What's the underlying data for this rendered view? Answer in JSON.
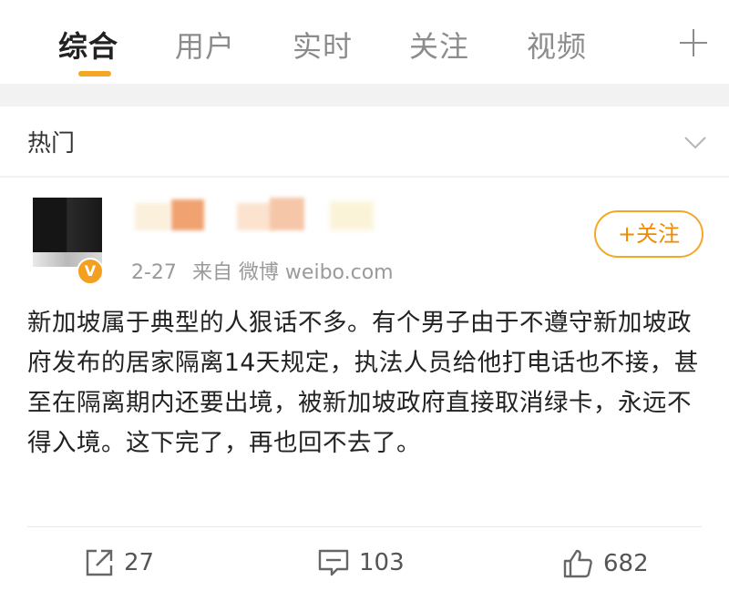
{
  "tabs": [
    {
      "label": "综合",
      "active": true
    },
    {
      "label": "用户",
      "active": false
    },
    {
      "label": "实时",
      "active": false
    },
    {
      "label": "关注",
      "active": false
    },
    {
      "label": "视频",
      "active": false
    }
  ],
  "hot_section": {
    "label": "热门"
  },
  "post": {
    "date": "2-27",
    "source": "来自 微博 weibo.com",
    "follow_label": "+关注",
    "badge": "V",
    "text": "新加坡属于典型的人狠话不多。有个男子由于不遵守新加坡政府发布的居家隔离14天规定，执法人员给他打电话也不接，甚至在隔离期内还要出境，被新加坡政府直接取消绿卡，永远不得入境。这下完了，再也回不去了。"
  },
  "actions": {
    "repost_count": "27",
    "comment_count": "103",
    "like_count": "682"
  },
  "colors": {
    "accent": "#f5a623",
    "follow_text": "#f08a00",
    "background": "#f2f2f2"
  },
  "icons": [
    "plus-icon",
    "chevron-down-icon",
    "verified-icon",
    "share-icon",
    "comment-icon",
    "like-icon"
  ]
}
